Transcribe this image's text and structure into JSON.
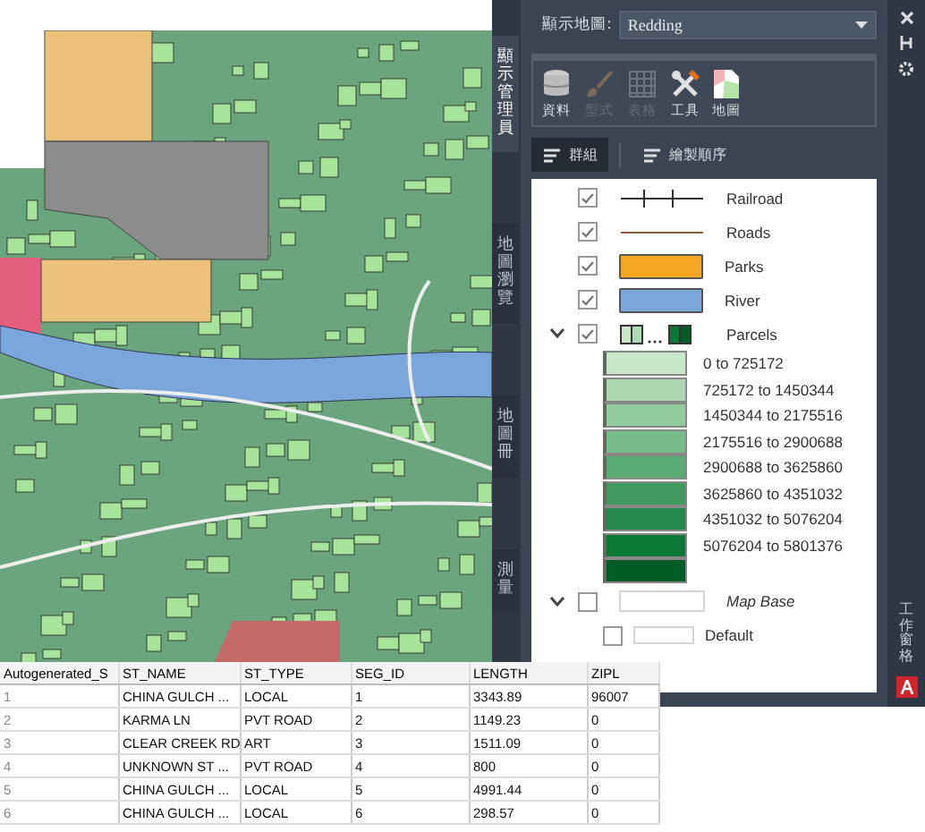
{
  "side_tabs": [
    {
      "label": "顯示管理員",
      "selected": true
    },
    {
      "label": "地圖瀏覽",
      "selected": false
    },
    {
      "label": "地圖冊",
      "selected": false
    },
    {
      "label": "測量",
      "selected": false
    }
  ],
  "map_selector": {
    "label": "顯示地圖:",
    "value": "Redding"
  },
  "toolbar": [
    {
      "label": "資料",
      "disabled": false,
      "kind": "data"
    },
    {
      "label": "型式",
      "disabled": true,
      "kind": "style"
    },
    {
      "label": "表格",
      "disabled": true,
      "kind": "table"
    },
    {
      "label": "工具",
      "disabled": false,
      "kind": "tools"
    },
    {
      "label": "地圖",
      "disabled": false,
      "kind": "map"
    }
  ],
  "view_buttons": [
    {
      "label": "群組",
      "selected": true
    },
    {
      "label": "繪製順序",
      "selected": false
    }
  ],
  "layers": [
    {
      "name": "Railroad",
      "kind": "rail",
      "checked": true
    },
    {
      "name": "Roads",
      "kind": "road",
      "checked": true
    },
    {
      "name": "Parks",
      "kind": "fill",
      "color": "#f5a623",
      "checked": true
    },
    {
      "name": "River",
      "kind": "fill",
      "color": "#7aa6dc",
      "checked": true
    },
    {
      "name": "Parcels",
      "kind": "theme",
      "checked": true,
      "expanded": true,
      "children": [
        {
          "label": "0 to 725172",
          "color": "#c9e8c9"
        },
        {
          "label": "725172 to 1450344",
          "color": "#acd9b2"
        },
        {
          "label": "1450344 to 2175516",
          "color": "#92cb9d"
        },
        {
          "label": "2175516 to 2900688",
          "color": "#76bb88"
        },
        {
          "label": "2900688 to 3625860",
          "color": "#5aaa74"
        },
        {
          "label": "3625860 to 4351032",
          "color": "#40995f"
        },
        {
          "label": "4351032 to 5076204",
          "color": "#26884a"
        },
        {
          "label": "5076204 to 5801376",
          "color": "#0c7836"
        },
        {
          "color": "#005d26"
        }
      ]
    },
    {
      "name": "Map Base",
      "kind": "group",
      "checked": false,
      "expanded": true,
      "children": [
        {
          "label": "Default",
          "checked": false
        }
      ]
    }
  ],
  "right_strip": {
    "label": "工作窗格"
  },
  "table": {
    "columns": [
      "Autogenerated_S",
      "ST_NAME",
      "ST_TYPE",
      "SEG_ID",
      "LENGTH",
      "ZIPL"
    ],
    "rows": [
      [
        "1",
        "CHINA GULCH ...",
        "LOCAL",
        "1",
        "3343.89",
        "96007"
      ],
      [
        "2",
        "KARMA LN",
        "PVT ROAD",
        "2",
        "1149.23",
        "0"
      ],
      [
        "3",
        "CLEAR CREEK RD",
        "ART",
        "3",
        "1511.09",
        "0"
      ],
      [
        "4",
        "UNKNOWN ST ...",
        "PVT ROAD",
        "4",
        "800",
        "0"
      ],
      [
        "5",
        "CHINA GULCH ...",
        "LOCAL",
        "5",
        "4991.44",
        "0"
      ],
      [
        "6",
        "CHINA GULCH ...",
        "LOCAL",
        "6",
        "298.57",
        "0"
      ]
    ]
  }
}
